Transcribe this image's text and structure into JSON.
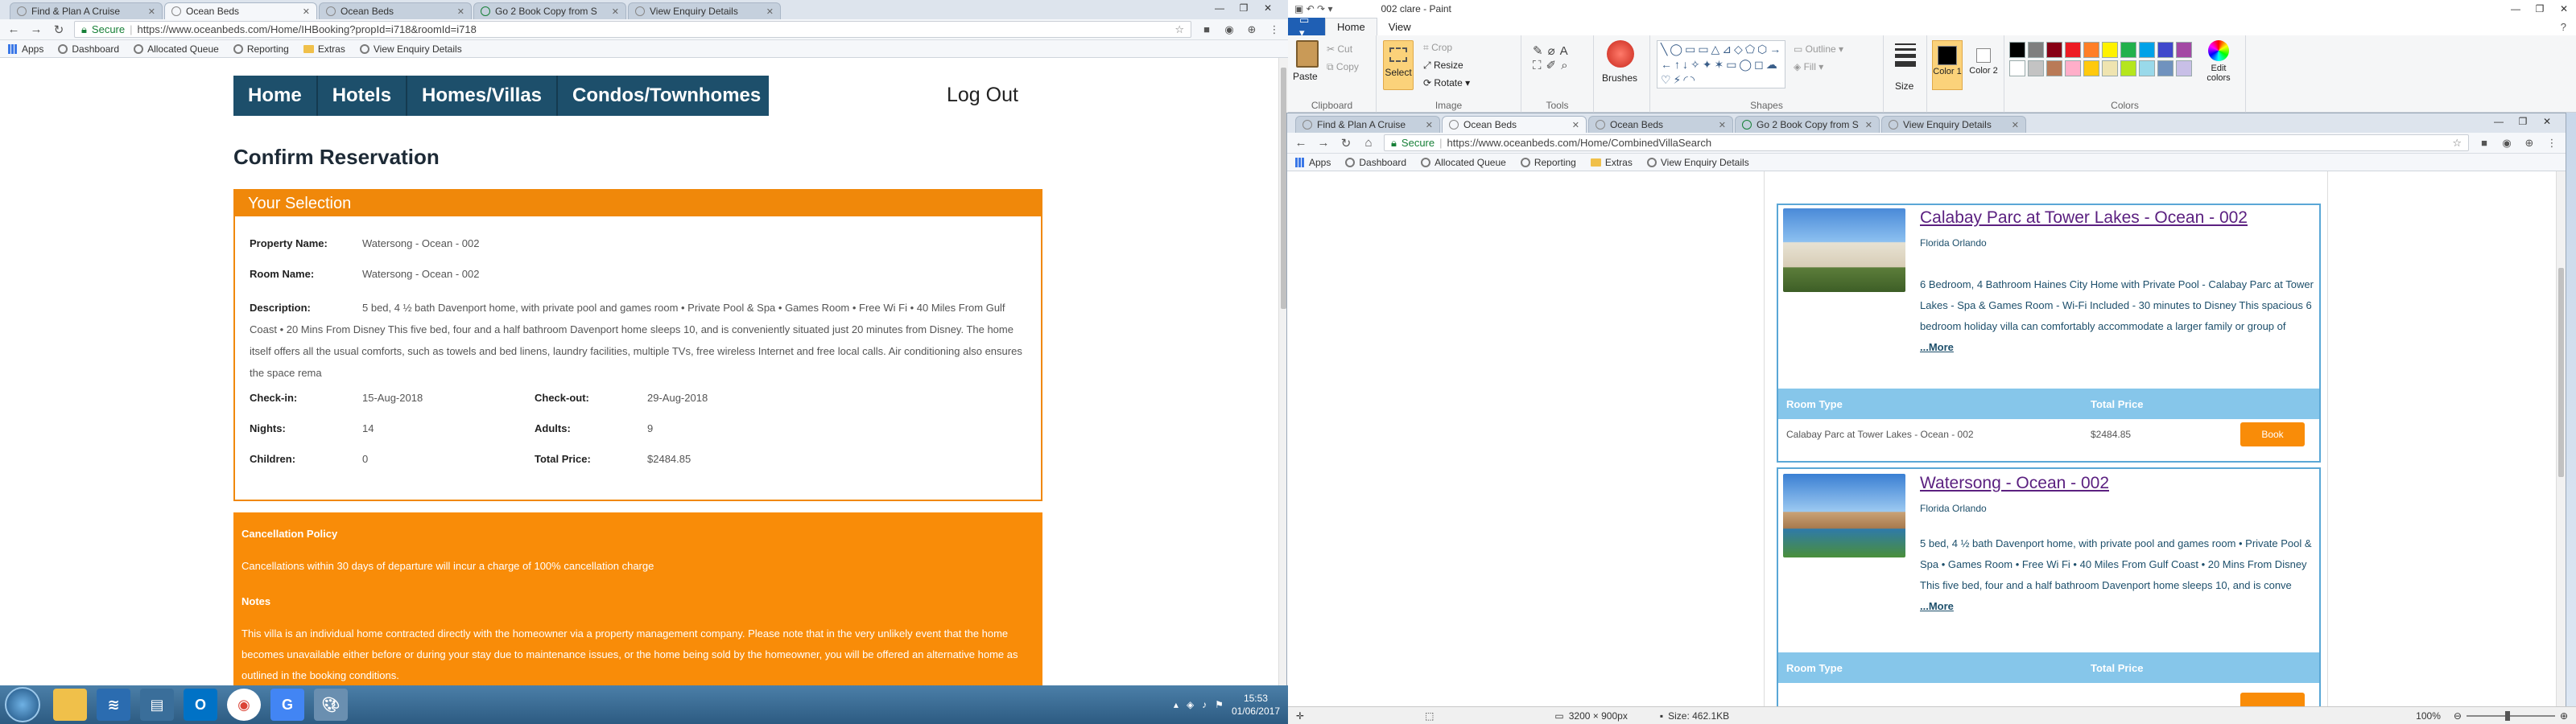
{
  "left_browser": {
    "tabs": [
      {
        "title": "Find & Plan A Cruise",
        "active": false
      },
      {
        "title": "Ocean Beds",
        "active": true
      },
      {
        "title": "Ocean Beds",
        "active": false
      },
      {
        "title": "Go 2 Book Copy from S",
        "active": false
      },
      {
        "title": "View Enquiry Details",
        "active": false
      }
    ],
    "secure": "Secure",
    "url": "https://www.oceanbeds.com/Home/IHBooking?propId=i718&roomId=i718",
    "bookmarks": [
      "Apps",
      "Dashboard",
      "Allocated Queue",
      "Reporting",
      "Extras",
      "View Enquiry Details"
    ]
  },
  "nav": {
    "items": [
      "Home",
      "Hotels",
      "Homes/Villas",
      "Condos/Townhomes"
    ],
    "logout": "Log Out"
  },
  "page_title": "Confirm Reservation",
  "selection": {
    "header": "Your Selection",
    "property_label": "Property Name:",
    "property_value": "Watersong - Ocean - 002",
    "room_label": "Room Name:",
    "room_value": "Watersong - Ocean - 002",
    "description_label": "Description:",
    "description_value": "5 bed, 4 ½ bath Davenport home, with private pool and games room • Private Pool & Spa • Games Room • Free Wi Fi • 40 Miles From Gulf Coast • 20 Mins From Disney This five bed, four and a half bathroom Davenport home sleeps 10, and is conveniently situated just 20 minutes from Disney. The home itself offers all the usual comforts, such as towels and bed linens, laundry facilities, multiple TVs, free wireless Internet and free local calls. Air conditioning also ensures the space rema",
    "checkin_label": "Check-in:",
    "checkin_value": "15-Aug-2018",
    "checkout_label": "Check-out:",
    "checkout_value": "29-Aug-2018",
    "nights_label": "Nights:",
    "nights_value": "14",
    "adults_label": "Adults:",
    "adults_value": "9",
    "children_label": "Children:",
    "children_value": "0",
    "total_label": "Total Price:",
    "total_value": "$2484.85"
  },
  "policy": {
    "cancel_title": "Cancellation Policy",
    "cancel_text": "Cancellations within 30 days of departure will incur a charge of 100% cancellation charge",
    "notes_title": "Notes",
    "notes_text": "This villa is an individual home contracted directly with the homeowner via a property management company. Please note that in the very unlikely event that the home becomes unavailable either before or during your stay due to maintenance issues, or the home being sold by the homeowner, you will be offered an alternative home as outlined in the booking conditions."
  },
  "paint": {
    "title": "002 clare - Paint",
    "tabs": [
      "Home",
      "View"
    ],
    "groups": {
      "clipboard": {
        "name": "Clipboard",
        "paste": "Paste",
        "cut": "Cut",
        "copy": "Copy"
      },
      "image": {
        "name": "Image",
        "select": "Select",
        "crop": "Crop",
        "resize": "Resize",
        "rotate": "Rotate"
      },
      "tools": {
        "name": "Tools"
      },
      "brushes": "Brushes",
      "shapes": {
        "name": "Shapes",
        "outline": "Outline",
        "fill": "Fill"
      },
      "size": "Size",
      "color1": "Color 1",
      "color2": "Color 2",
      "colors": {
        "name": "Colors",
        "edit": "Edit colors"
      }
    },
    "palette": [
      "#000000",
      "#7f7f7f",
      "#880015",
      "#ed1c24",
      "#ff7f27",
      "#fff200",
      "#22b14c",
      "#00a2e8",
      "#3f48cc",
      "#a349a4",
      "#ffffff",
      "#c3c3c3",
      "#b97a57",
      "#ffaec9",
      "#ffc90e",
      "#efe4b0",
      "#b5e61d",
      "#99d9ea",
      "#7092be",
      "#c8bfe7"
    ],
    "status": {
      "dimensions": "3200 × 900px",
      "size": "Size: 462.1KB",
      "zoom": "100%"
    }
  },
  "right_browser": {
    "tabs": [
      {
        "title": "Find & Plan A Cruise",
        "active": false
      },
      {
        "title": "Ocean Beds",
        "active": true
      },
      {
        "title": "Ocean Beds",
        "active": false
      },
      {
        "title": "Go 2 Book Copy from S",
        "active": false
      },
      {
        "title": "View Enquiry Details",
        "active": false
      }
    ],
    "secure": "Secure",
    "url": "https://www.oceanbeds.com/Home/CombinedVillaSearch",
    "bookmarks": [
      "Apps",
      "Dashboard",
      "Allocated Queue",
      "Reporting",
      "Extras",
      "View Enquiry Details"
    ],
    "listings": [
      {
        "title": "Calabay Parc at Tower Lakes - Ocean - 002",
        "location": "Florida Orlando",
        "description": "6 Bedroom, 4 Bathroom Haines City Home with Private Pool - Calabay Parc at Tower Lakes - Spa & Games Room - Wi-Fi Included - 30 minutes to Disney This spacious 6 bedroom holiday villa can comfortably accommodate a larger family or group of",
        "more": "...More",
        "room_type_header": "Room Type",
        "total_price_header": "Total Price",
        "room_name": "Calabay Parc at Tower Lakes - Ocean - 002",
        "price": "$2484.85",
        "book": "Book"
      },
      {
        "title": "Watersong - Ocean - 002",
        "location": "Florida Orlando",
        "description": "5 bed, 4 ½ bath Davenport home, with private pool and games room • Private Pool & Spa • Games Room • Free Wi Fi • 40 Miles From Gulf Coast • 20 Mins From Disney This five bed, four and a half bathroom Davenport home sleeps 10, and is conveniently situated just 20 minutes from Disney. The home itself offers all the usual comforts, such as towels and bed linens, laundry facilities, multiple TVs, free wireless Internet and free local calls. Air conditioning also ensures the space rema",
        "desc_short": "5 bed, 4 ½ bath Davenport home, with private pool and games room • Private Pool & Spa • Games Room • Free Wi Fi • 40 Miles From Gulf Coast • 20 Mins From Disney This five bed, four and a half bathroom Davenport home sleeps 10, and is conve",
        "more": "...More",
        "room_type_header": "Room Type",
        "total_price_header": "Total Price"
      }
    ]
  },
  "taskbar": {
    "time": "15:53",
    "date": "01/06/2017"
  },
  "colors": {
    "nav_bg": "#1d4f6b",
    "orange": "#f98c08",
    "link_purple": "#5b2080",
    "room_bar": "#86c6ea"
  }
}
